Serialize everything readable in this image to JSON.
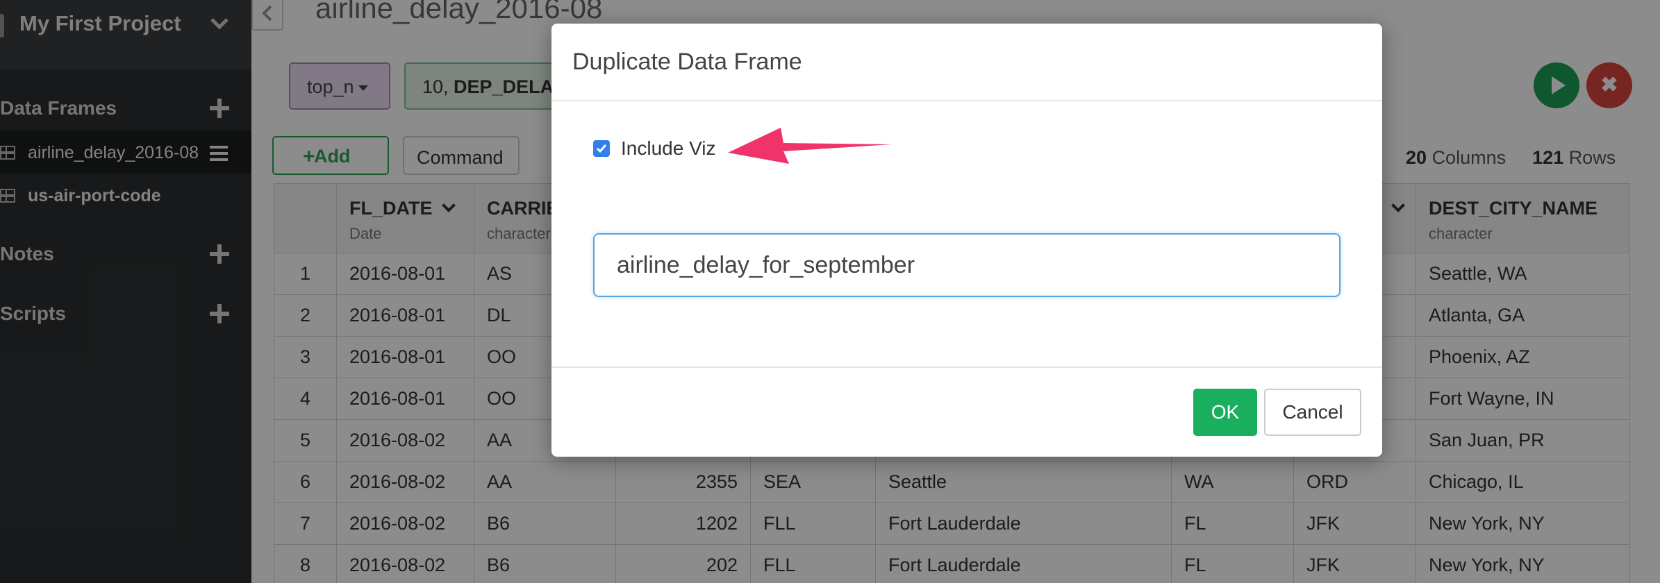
{
  "sidebar": {
    "project_title": "My First Project",
    "sections": {
      "data_frames": "Data Frames",
      "notes": "Notes",
      "scripts": "Scripts"
    },
    "data_frames": [
      {
        "label": "airline_delay_2016-08",
        "active": true
      },
      {
        "label": "us-air-port-code",
        "active": false
      }
    ]
  },
  "main": {
    "frame_title": "airline_delay_2016-08",
    "command": {
      "function": "top_n",
      "arg_prefix": "10, ",
      "arg_bold": "DEP_DELAY"
    },
    "toolbar": {
      "add_label": "Add",
      "command_label": "Command"
    },
    "stats": {
      "columns_count": "20",
      "columns_label": "Columns",
      "rows_count": "121",
      "rows_label": "Rows"
    },
    "table": {
      "columns": [
        {
          "name": "FL_DATE",
          "type": "Date"
        },
        {
          "name": "CARRIER",
          "type": "character"
        },
        {
          "name": "",
          "type": ""
        },
        {
          "name": "",
          "type": ""
        },
        {
          "name": "",
          "type": ""
        },
        {
          "name": "",
          "type": ""
        },
        {
          "name": "",
          "type": ""
        },
        {
          "name": "DEST_CITY_NAME",
          "type": "character"
        }
      ],
      "rows": [
        [
          "1",
          "2016-08-01",
          "AS",
          "",
          "",
          "",
          "",
          "",
          "Seattle, WA"
        ],
        [
          "2",
          "2016-08-01",
          "DL",
          "",
          "",
          "",
          "",
          "",
          "Atlanta, GA"
        ],
        [
          "3",
          "2016-08-01",
          "OO",
          "",
          "",
          "",
          "",
          "",
          "Phoenix, AZ"
        ],
        [
          "4",
          "2016-08-01",
          "OO",
          "",
          "",
          "",
          "",
          "",
          "Fort Wayne, IN"
        ],
        [
          "5",
          "2016-08-02",
          "AA",
          "",
          "",
          "",
          "",
          "",
          "San Juan, PR"
        ],
        [
          "6",
          "2016-08-02",
          "AA",
          "2355",
          "SEA",
          "Seattle",
          "WA",
          "ORD",
          "Chicago, IL"
        ],
        [
          "7",
          "2016-08-02",
          "B6",
          "1202",
          "FLL",
          "Fort Lauderdale",
          "FL",
          "JFK",
          "New York, NY"
        ],
        [
          "8",
          "2016-08-02",
          "B6",
          "202",
          "FLL",
          "Fort Lauderdale",
          "FL",
          "JFK",
          "New York, NY"
        ]
      ]
    }
  },
  "modal": {
    "title": "Duplicate Data Frame",
    "include_viz_label": "Include Viz",
    "include_viz_checked": true,
    "name_value": "airline_delay_for_september",
    "ok_label": "OK",
    "cancel_label": "Cancel",
    "arrow_color": "#f0336a",
    "accent_color": "#1aaf5d"
  }
}
